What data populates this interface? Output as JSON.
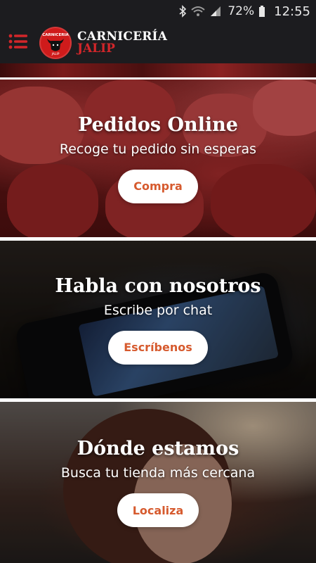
{
  "status_bar": {
    "battery_percent": "72%",
    "time": "12:55",
    "icons": [
      "bluetooth-icon",
      "wifi-icon",
      "signal-icon",
      "battery-icon"
    ]
  },
  "header": {
    "brand_line1": "CARNICERÍA",
    "brand_line2": "JALIP",
    "menu_icon": "hamburger-menu-icon",
    "logo_icon": "bull-logo-icon",
    "logo_text_top": "CARNICERIA",
    "logo_text_bottom": "JALIP",
    "colors": {
      "bar": "#1c1c1f",
      "accent": "#cf1b1b"
    }
  },
  "sections": [
    {
      "title": "Pedidos Online",
      "subtitle": "Recoge tu pedido sin esperas",
      "button_label": "Compra"
    },
    {
      "title": "Habla con nosotros",
      "subtitle": "Escribe por chat",
      "button_label": "Escríbenos"
    },
    {
      "title": "Dónde estamos",
      "subtitle": "Busca tu tienda más cercana",
      "button_label": "Localiza"
    }
  ],
  "button_text_color": "#d65a2e"
}
